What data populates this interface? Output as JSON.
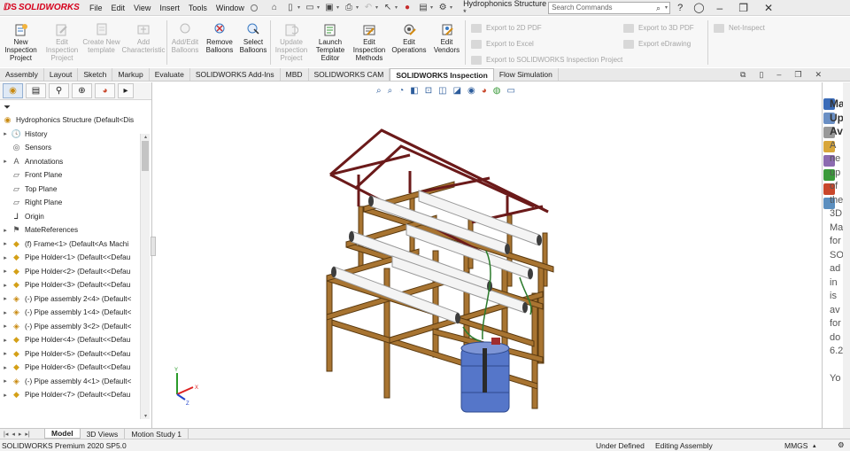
{
  "app": {
    "logo_text": "SOLIDWORKS",
    "document_title": "Hydrophonics Structure *",
    "search_placeholder": "Search Commands"
  },
  "menu": [
    "File",
    "Edit",
    "View",
    "Insert",
    "Tools",
    "Window"
  ],
  "window_controls": {
    "minimize": "–",
    "restore": "❐",
    "close": "✕"
  },
  "commands": {
    "new_inspection_project": "New Inspection Project",
    "edit_inspection_project": "Edit Inspection Project",
    "create_new_template": "Create New template",
    "add_characteristic": "Add Characteristic",
    "add_edit_balloons": "Add/Edit Balloons",
    "remove_balloons": "Remove Balloons",
    "select_balloons": "Select Balloons",
    "update_inspection_project": "Update Inspection Project",
    "launch_template_editor": "Launch Template Editor",
    "edit_inspection_methods": "Edit Inspection Methods",
    "edit_operations": "Edit Operations",
    "edit_vendors": "Edit Vendors",
    "export_2d_pdf": "Export to 2D PDF",
    "export_excel": "Export to Excel",
    "export_inspection_project": "Export to SOLIDWORKS Inspection Project",
    "export_3d_pdf": "Export to 3D PDF",
    "export_edrawing": "Export eDrawing",
    "net_inspect": "Net-Inspect"
  },
  "tabs": [
    "Assembly",
    "Layout",
    "Sketch",
    "Markup",
    "Evaluate",
    "SOLIDWORKS Add-Ins",
    "MBD",
    "SOLIDWORKS CAM",
    "SOLIDWORKS Inspection",
    "Flow Simulation"
  ],
  "active_tab": "SOLIDWORKS Inspection",
  "tree": {
    "root": "Hydrophonics Structure (Default<Dis",
    "items": [
      {
        "label": "History",
        "icon": "history-icon",
        "expand": "▸"
      },
      {
        "label": "Sensors",
        "icon": "sensors-icon",
        "expand": ""
      },
      {
        "label": "Annotations",
        "icon": "annotations-icon",
        "expand": "▸"
      },
      {
        "label": "Front Plane",
        "icon": "plane-icon",
        "expand": ""
      },
      {
        "label": "Top Plane",
        "icon": "plane-icon",
        "expand": ""
      },
      {
        "label": "Right Plane",
        "icon": "plane-icon",
        "expand": ""
      },
      {
        "label": "Origin",
        "icon": "origin-icon",
        "expand": ""
      },
      {
        "label": "MateReferences",
        "icon": "mate-references-icon",
        "expand": "▸"
      },
      {
        "label": "(f) Frame<1> (Default<As Machi",
        "icon": "part-icon",
        "expand": "▸"
      },
      {
        "label": "Pipe Holder<1> (Default<<Defau",
        "icon": "part-icon",
        "expand": "▸"
      },
      {
        "label": "Pipe Holder<2> (Default<<Defau",
        "icon": "part-icon",
        "expand": "▸"
      },
      {
        "label": "Pipe Holder<3> (Default<<Defau",
        "icon": "part-icon",
        "expand": "▸"
      },
      {
        "label": "(-) Pipe assembly 2<4> (Default<",
        "icon": "assembly-icon",
        "expand": "▸"
      },
      {
        "label": "(-) Pipe assembly 1<4> (Default<",
        "icon": "assembly-icon",
        "expand": "▸"
      },
      {
        "label": "(-) Pipe assembly 3<2> (Default<",
        "icon": "assembly-icon",
        "expand": "▸"
      },
      {
        "label": "Pipe Holder<4> (Default<<Defau",
        "icon": "part-icon",
        "expand": "▸"
      },
      {
        "label": "Pipe Holder<5> (Default<<Defau",
        "icon": "part-icon",
        "expand": "▸"
      },
      {
        "label": "Pipe Holder<6> (Default<<Defau",
        "icon": "part-icon",
        "expand": "▸"
      },
      {
        "label": "(-) Pipe assembly 4<1> (Default<",
        "icon": "assembly-icon",
        "expand": "▸"
      },
      {
        "label": "Pipe Holder<7> (Default<<Defau",
        "icon": "part-icon",
        "expand": "▸"
      }
    ]
  },
  "triad": {
    "x": "X",
    "y": "Y",
    "z": "Z"
  },
  "taskpane": {
    "lines": [
      "Ma",
      "Up",
      "Av",
      "A",
      "ne",
      "up",
      "of",
      "the",
      "3D",
      "Ma",
      "for",
      "SO",
      "ad",
      "in",
      "is",
      "av",
      "for",
      "do",
      "6.2",
      "",
      "Yo"
    ]
  },
  "bottom_tabs": [
    "Model",
    "3D Views",
    "Motion Study 1"
  ],
  "active_bottom_tab": "Model",
  "status": {
    "version": "SOLIDWORKS Premium 2020 SP5.0",
    "definition": "Under Defined",
    "mode": "Editing Assembly",
    "units": "MMGS",
    "units_dropdown": "▴"
  },
  "colors": {
    "brand_red": "#d6001c",
    "frame_brown": "#8a5a1c",
    "roof_maroon": "#7a1f1f",
    "pipe_white": "#f4f4f4",
    "tank_blue": "#4f6fbf"
  }
}
